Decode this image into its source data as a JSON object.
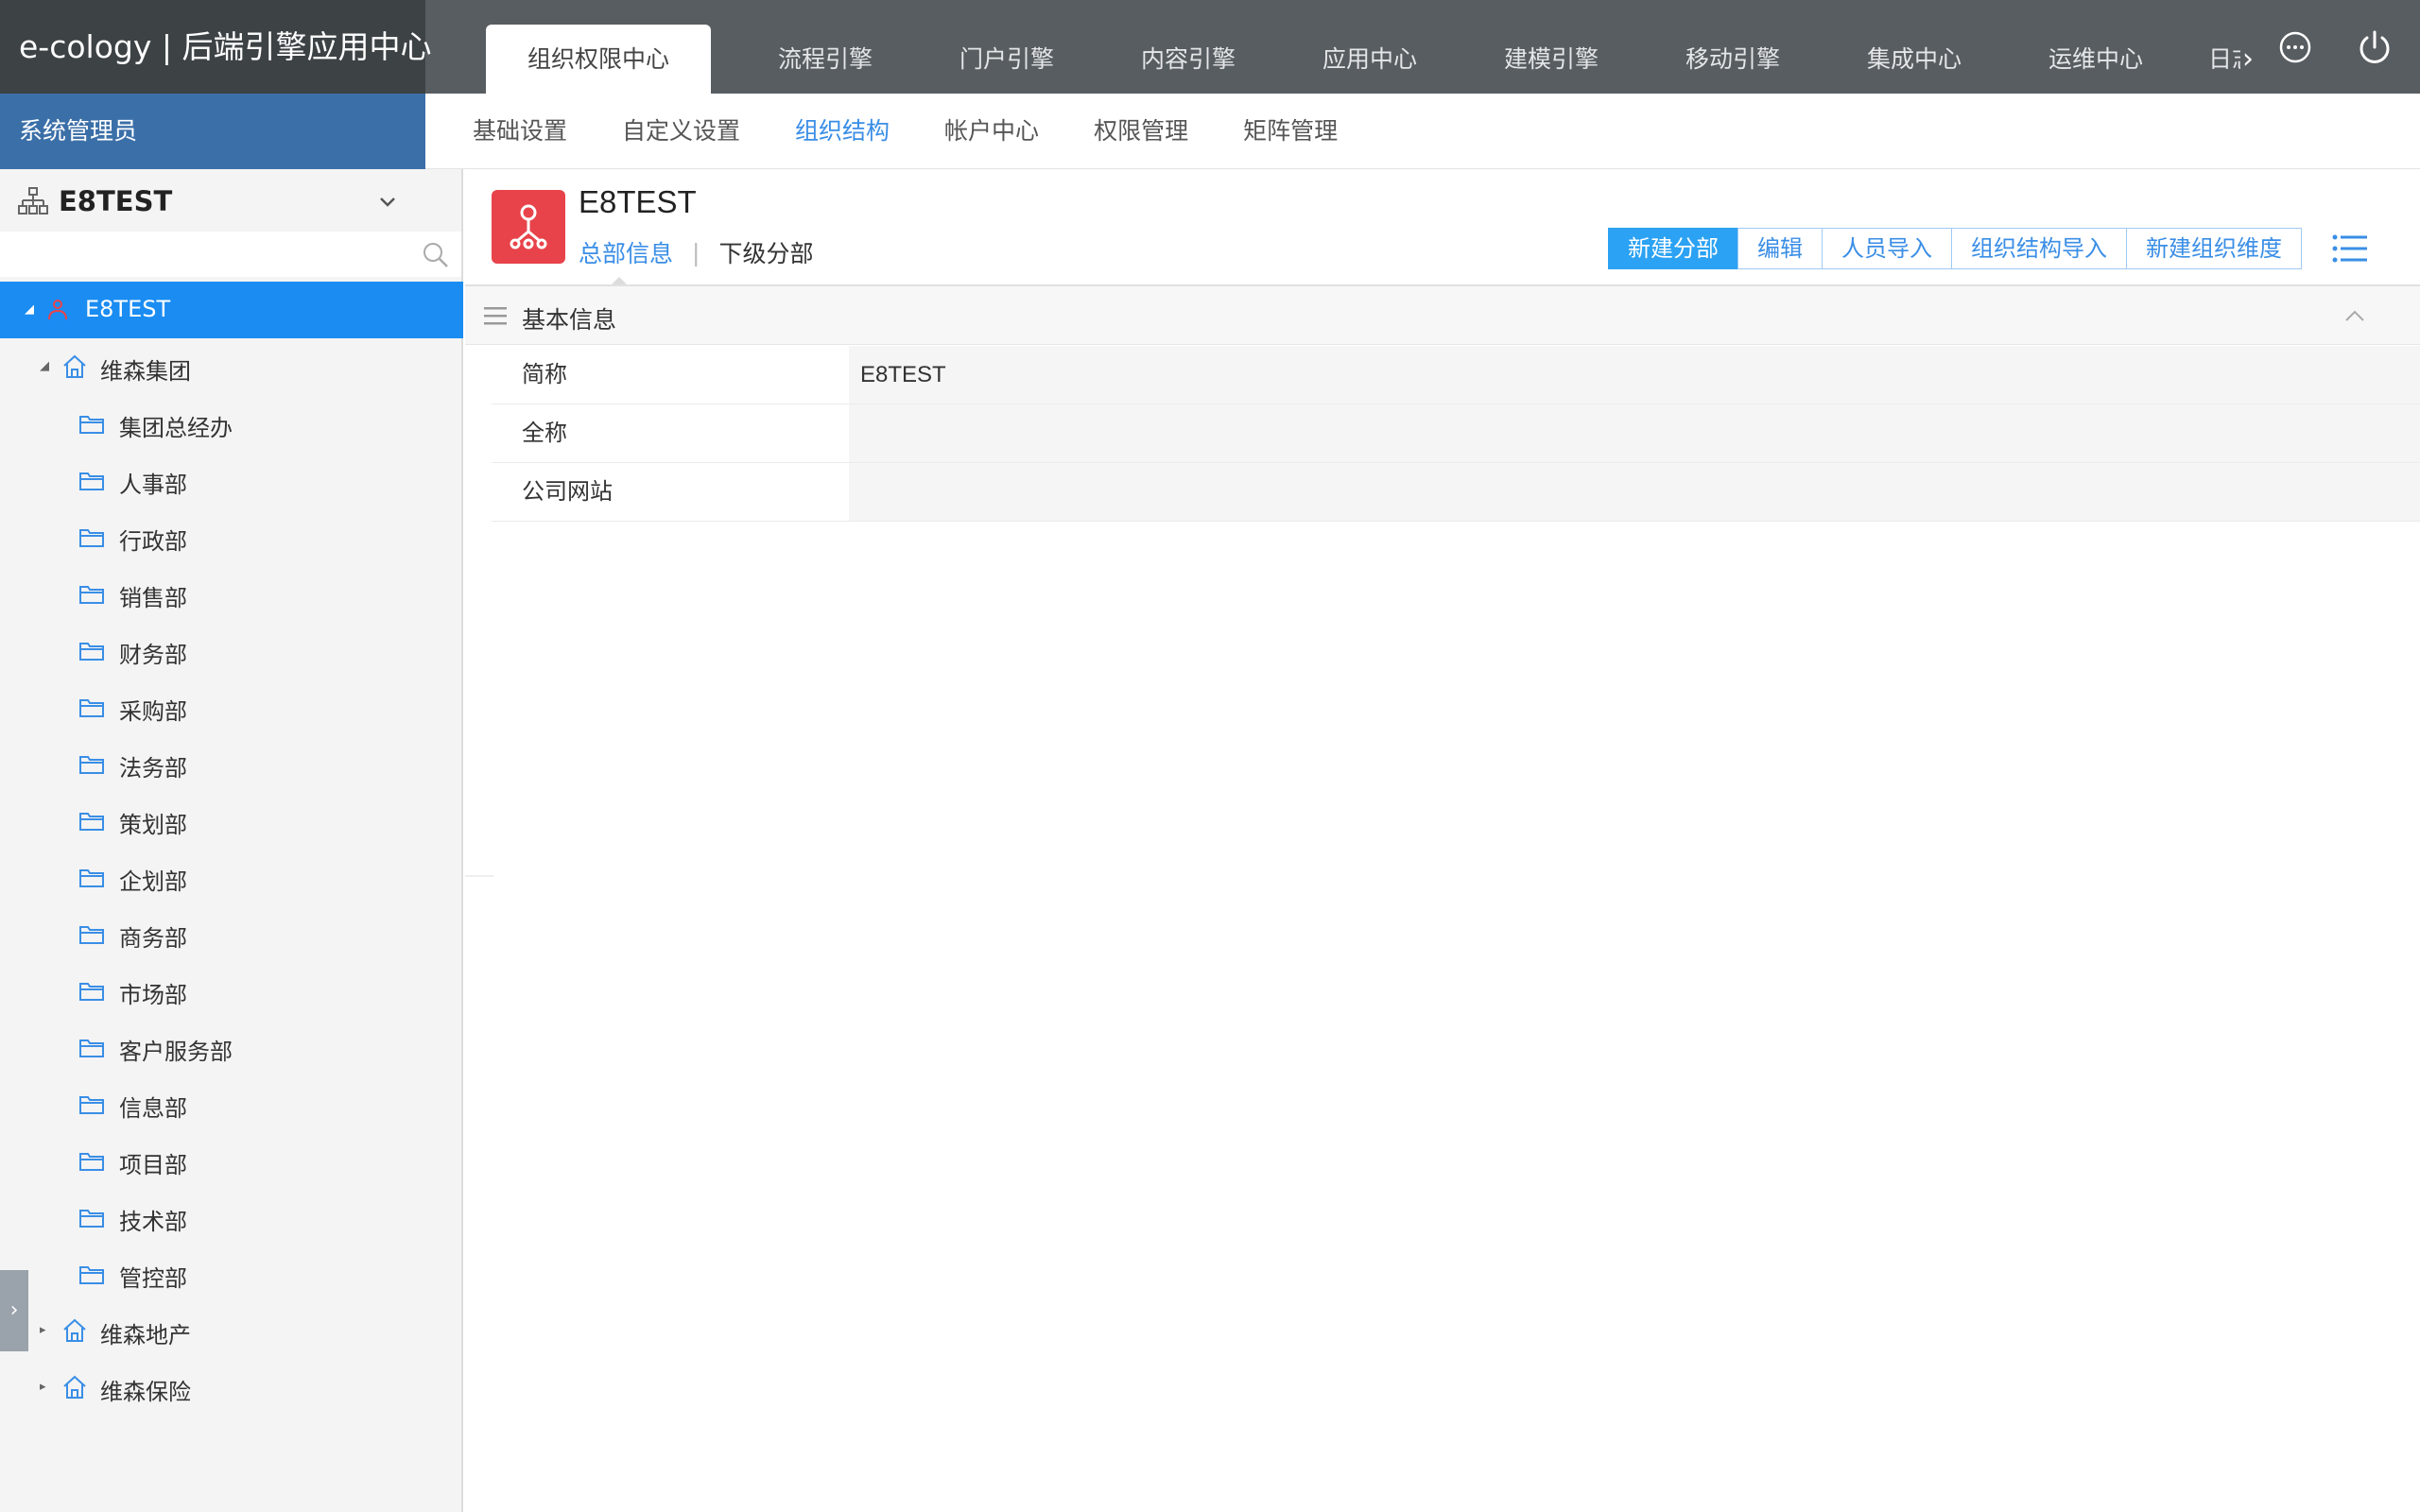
{
  "app": {
    "brand": "e-cology | 后端引擎应用中心",
    "user": "系统管理员"
  },
  "top_tabs": [
    {
      "label": "组织权限中心",
      "active": true
    },
    {
      "label": "流程引擎"
    },
    {
      "label": "门户引擎"
    },
    {
      "label": "内容引擎"
    },
    {
      "label": "应用中心"
    },
    {
      "label": "建模引擎"
    },
    {
      "label": "移动引擎"
    },
    {
      "label": "集成中心"
    },
    {
      "label": "运维中心"
    },
    {
      "label": "日志"
    }
  ],
  "top_icons": {
    "more": "chevron-right-icon",
    "menu": "ellipsis-circle-icon",
    "power": "power-icon"
  },
  "sub_nav": [
    {
      "label": "基础设置"
    },
    {
      "label": "自定义设置"
    },
    {
      "label": "组织结构",
      "active": true
    },
    {
      "label": "帐户中心"
    },
    {
      "label": "权限管理"
    },
    {
      "label": "矩阵管理"
    }
  ],
  "sidebar": {
    "org_name": "E8TEST",
    "search_placeholder": "",
    "tree": [
      {
        "label": "E8TEST",
        "level": 0,
        "type": "root",
        "expanded": true,
        "selected": true
      },
      {
        "label": "维森集团",
        "level": 1,
        "type": "company",
        "expanded": true
      },
      {
        "label": "集团总经办",
        "level": 2,
        "type": "dept"
      },
      {
        "label": "人事部",
        "level": 2,
        "type": "dept"
      },
      {
        "label": "行政部",
        "level": 2,
        "type": "dept"
      },
      {
        "label": "销售部",
        "level": 2,
        "type": "dept"
      },
      {
        "label": "财务部",
        "level": 2,
        "type": "dept"
      },
      {
        "label": "采购部",
        "level": 2,
        "type": "dept"
      },
      {
        "label": "法务部",
        "level": 2,
        "type": "dept"
      },
      {
        "label": "策划部",
        "level": 2,
        "type": "dept"
      },
      {
        "label": "企划部",
        "level": 2,
        "type": "dept"
      },
      {
        "label": "商务部",
        "level": 2,
        "type": "dept"
      },
      {
        "label": "市场部",
        "level": 2,
        "type": "dept"
      },
      {
        "label": "客户服务部",
        "level": 2,
        "type": "dept"
      },
      {
        "label": "信息部",
        "level": 2,
        "type": "dept"
      },
      {
        "label": "项目部",
        "level": 2,
        "type": "dept"
      },
      {
        "label": "技术部",
        "level": 2,
        "type": "dept"
      },
      {
        "label": "管控部",
        "level": 2,
        "type": "dept"
      },
      {
        "label": "维森地产",
        "level": 1,
        "type": "company",
        "expanded": false
      },
      {
        "label": "维森保险",
        "level": 1,
        "type": "company",
        "expanded": false
      }
    ]
  },
  "main": {
    "title": "E8TEST",
    "tabs": [
      {
        "label": "总部信息",
        "active": true
      },
      {
        "label": "下级分部"
      }
    ],
    "tab_separator": "|",
    "buttons": [
      {
        "label": "新建分部",
        "primary": true
      },
      {
        "label": "编辑"
      },
      {
        "label": "人员导入"
      },
      {
        "label": "组织结构导入"
      },
      {
        "label": "新建组织维度"
      }
    ],
    "section_title": "基本信息",
    "fields": [
      {
        "label": "简称",
        "value": "E8TEST"
      },
      {
        "label": "全称",
        "value": ""
      },
      {
        "label": "公司网站",
        "value": ""
      }
    ]
  },
  "colors": {
    "topbar": "#585d61",
    "brand_bg": "#3d4245",
    "userbar": "#3b6fa8",
    "accent": "#1a8cf2",
    "link": "#3a8ee6",
    "org_icon": "#e8434a"
  }
}
